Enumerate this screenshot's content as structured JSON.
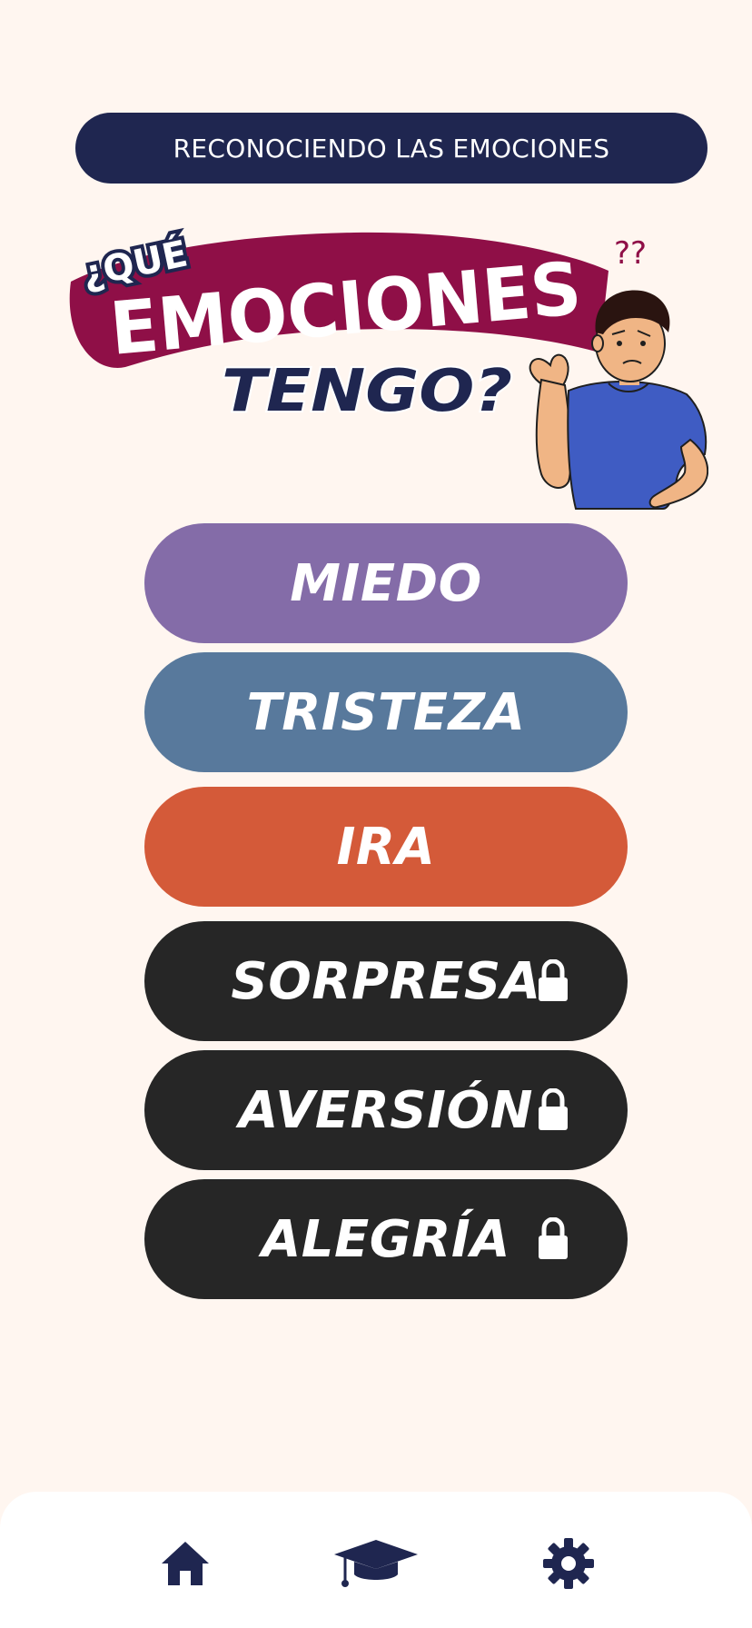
{
  "header": {
    "title": "RECONOCIENDO LAS EMOCIONES"
  },
  "title_art": {
    "question_prefix": "¿QUÉ",
    "main_word": "EMOCIONES",
    "sub_word": "TENGO?",
    "question_marks": "??",
    "banner_color": "#8f0f47",
    "navy": "#1f2650"
  },
  "emotions": [
    {
      "label": "MIEDO",
      "color": "#846ca8",
      "locked": false
    },
    {
      "label": "TRISTEZA",
      "color": "#58799c",
      "locked": false
    },
    {
      "label": "IRA",
      "color": "#d45a39",
      "locked": false
    },
    {
      "label": "SORPRESA",
      "color": "#262626",
      "locked": true
    },
    {
      "label": "AVERSIÓN",
      "color": "#262626",
      "locked": true
    },
    {
      "label": "ALEGRÍA",
      "color": "#262626",
      "locked": true
    }
  ],
  "icons": {
    "lock": "lock-icon",
    "home": "home-icon",
    "graduation": "graduation-cap-icon",
    "settings": "gear-icon"
  },
  "nav": {
    "color": "#1f2650",
    "items": [
      "home",
      "courses",
      "settings"
    ]
  }
}
